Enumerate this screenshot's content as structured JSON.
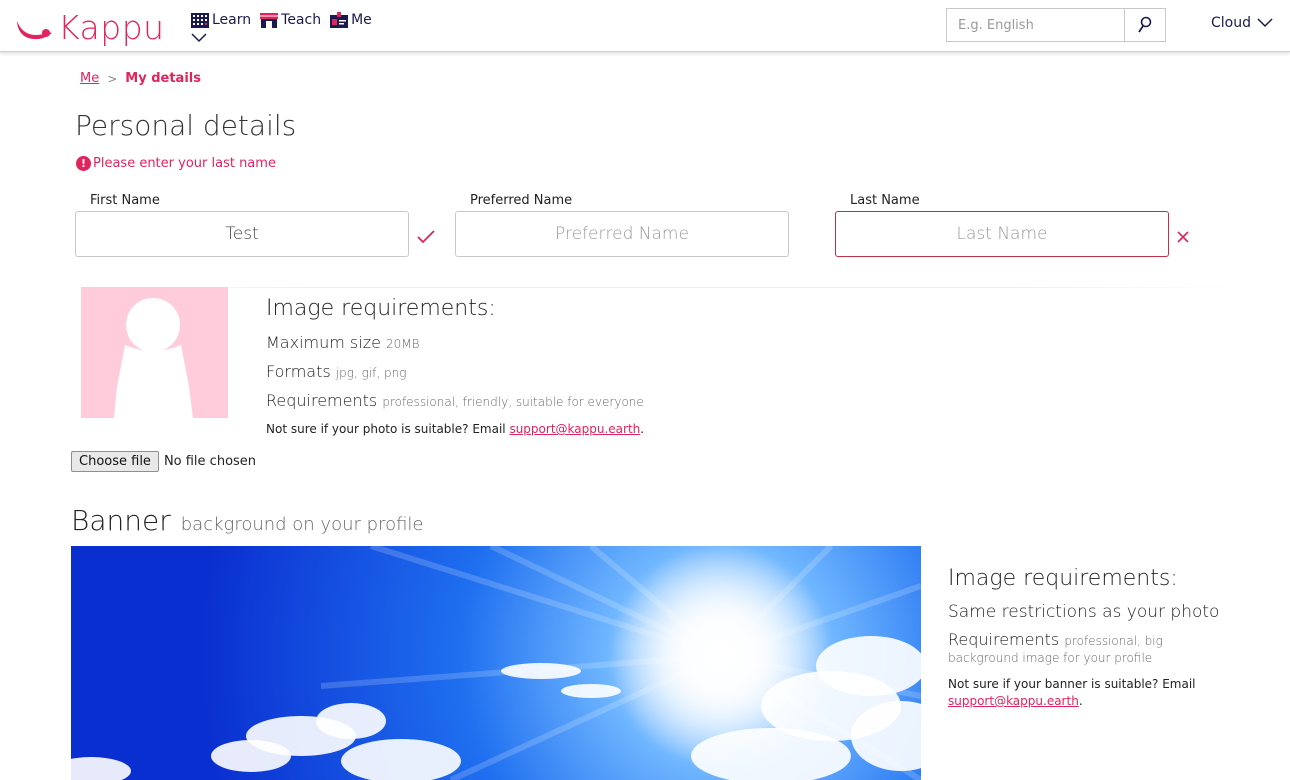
{
  "header": {
    "brand": "Kappu",
    "nav": [
      {
        "label": "Learn",
        "icon": "calendar-grid-icon"
      },
      {
        "label": "Teach",
        "icon": "shop-icon"
      },
      {
        "label": "Me",
        "icon": "id-badge-icon"
      }
    ],
    "search_placeholder": "E.g. English",
    "user_name": "Cloud"
  },
  "breadcrumb": {
    "parent": "Me",
    "separator": ">",
    "current": "My details"
  },
  "personal": {
    "title": "Personal details",
    "error_icon": "!",
    "error": "Please enter your last name",
    "first_name": {
      "label": "First Name",
      "value": "Test",
      "placeholder": "First Name"
    },
    "preferred_name": {
      "label": "Preferred Name",
      "value": "",
      "placeholder": "Preferred Name"
    },
    "last_name": {
      "label": "Last Name",
      "value": "",
      "placeholder": "Last Name"
    }
  },
  "photo_requirements": {
    "title": "Image requirements:",
    "max_size_label": "Maximum size",
    "max_size_value": "20MB",
    "formats_label": "Formats",
    "formats_value": "jpg, gif, png",
    "requirements_label": "Requirements",
    "requirements_value": "professional, friendly, suitable for everyone",
    "note": "Not sure if your photo is suitable? Email",
    "email": "support@kappu.earth",
    "note_end": "."
  },
  "file_input": {
    "button": "Choose file",
    "status": "No file chosen"
  },
  "banner": {
    "title": "Banner",
    "subtitle": "background on your profile"
  },
  "banner_requirements": {
    "title": "Image requirements:",
    "same": "Same restrictions as your photo",
    "requirements_label": "Requirements",
    "requirements_value_1": "professional, big",
    "requirements_value_2": "background image for your profile",
    "note": "Not sure if your banner is suitable? Email",
    "email": "support@kappu.earth",
    "note_end": "."
  },
  "colors": {
    "brand": "#e0245e",
    "nav_text": "#1a1a50",
    "avatar_bg": "#ffccdc",
    "error_border": "#c0304a"
  }
}
